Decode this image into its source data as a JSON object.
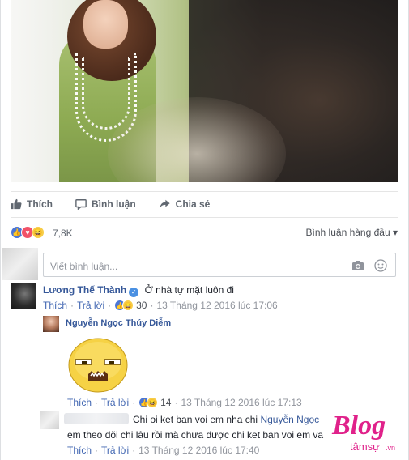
{
  "actions": {
    "like": "Thích",
    "comment": "Bình luận",
    "share": "Chia sẻ"
  },
  "reactions": {
    "count": "7,8K",
    "sort_label": "Bình luận hàng đầu",
    "sort_caret": "▾"
  },
  "write_comment": {
    "placeholder": "Viết bình luận..."
  },
  "comments": [
    {
      "name": "Lương Thế Thành",
      "text": "Ở nhà tự mặt luôn đi",
      "like": "Thích",
      "reply": "Trả lời",
      "reaction_count": "30",
      "time": "13 Tháng 12 2016 lúc 17:06"
    }
  ],
  "replies": [
    {
      "name": "Nguyễn Ngọc Thúy Diễm",
      "like": "Thích",
      "reply": "Trả lời",
      "reaction_count": "14",
      "time": "13 Tháng 12 2016 lúc 17:13"
    },
    {
      "text_line1": "Chi oi ket ban voi em nha chi",
      "mention": "Nguyễn Ngọc",
      "text_line2": "em theo dõi chi lâu rồi mà chưa được chi ket ban voi em va",
      "like": "Thích",
      "reply": "Trả lời",
      "time": "13 Tháng 12 2016 lúc 17:40"
    }
  ],
  "watermark": {
    "brand": "Blog",
    "sub": "tâmsự",
    "suffix": ".vn"
  },
  "colors": {
    "link": "#365899",
    "meta": "#90949c",
    "like_blue": "#4b76d6",
    "love_red": "#f25268",
    "haha_yellow": "#f7cd47",
    "watermark_pink": "#e0218a"
  }
}
